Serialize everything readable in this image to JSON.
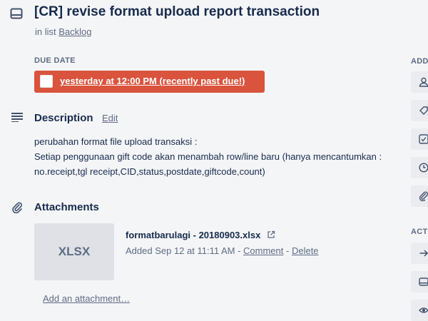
{
  "card": {
    "title": "[CR] revise format upload report transaction",
    "in_list_prefix": "in list",
    "list_name": "Backlog"
  },
  "due_date": {
    "label": "DUE DATE",
    "text": "yesterday at 12:00 PM (recently past due!)",
    "status_color": "#d9533d"
  },
  "description": {
    "heading": "Description",
    "edit_label": "Edit",
    "body": "perubahan format file upload transaksi :\nSetiap penggunaan gift code akan menambah row/line baru (hanya mencantumkan : no.receipt,tgl receipt,CID,status,postdate,giftcode,count)"
  },
  "attachments": {
    "heading": "Attachments",
    "items": [
      {
        "thumb_text": "XLSX",
        "name": "formatbarulagi - 20180903.xlsx",
        "added": "Added Sep 12 at 11:11 AM",
        "comment_label": "Comment",
        "delete_label": "Delete"
      }
    ],
    "add_label": "Add an attachment…"
  },
  "sidebar": {
    "add_label": "ADD",
    "actions_label": "ACT"
  },
  "icons": [
    "card-icon",
    "description-icon",
    "paperclip-icon",
    "external-link-icon",
    "member-icon",
    "label-icon",
    "checklist-icon",
    "clock-icon",
    "attachment-icon",
    "arrow-right-icon",
    "copy-icon",
    "eye-icon"
  ]
}
